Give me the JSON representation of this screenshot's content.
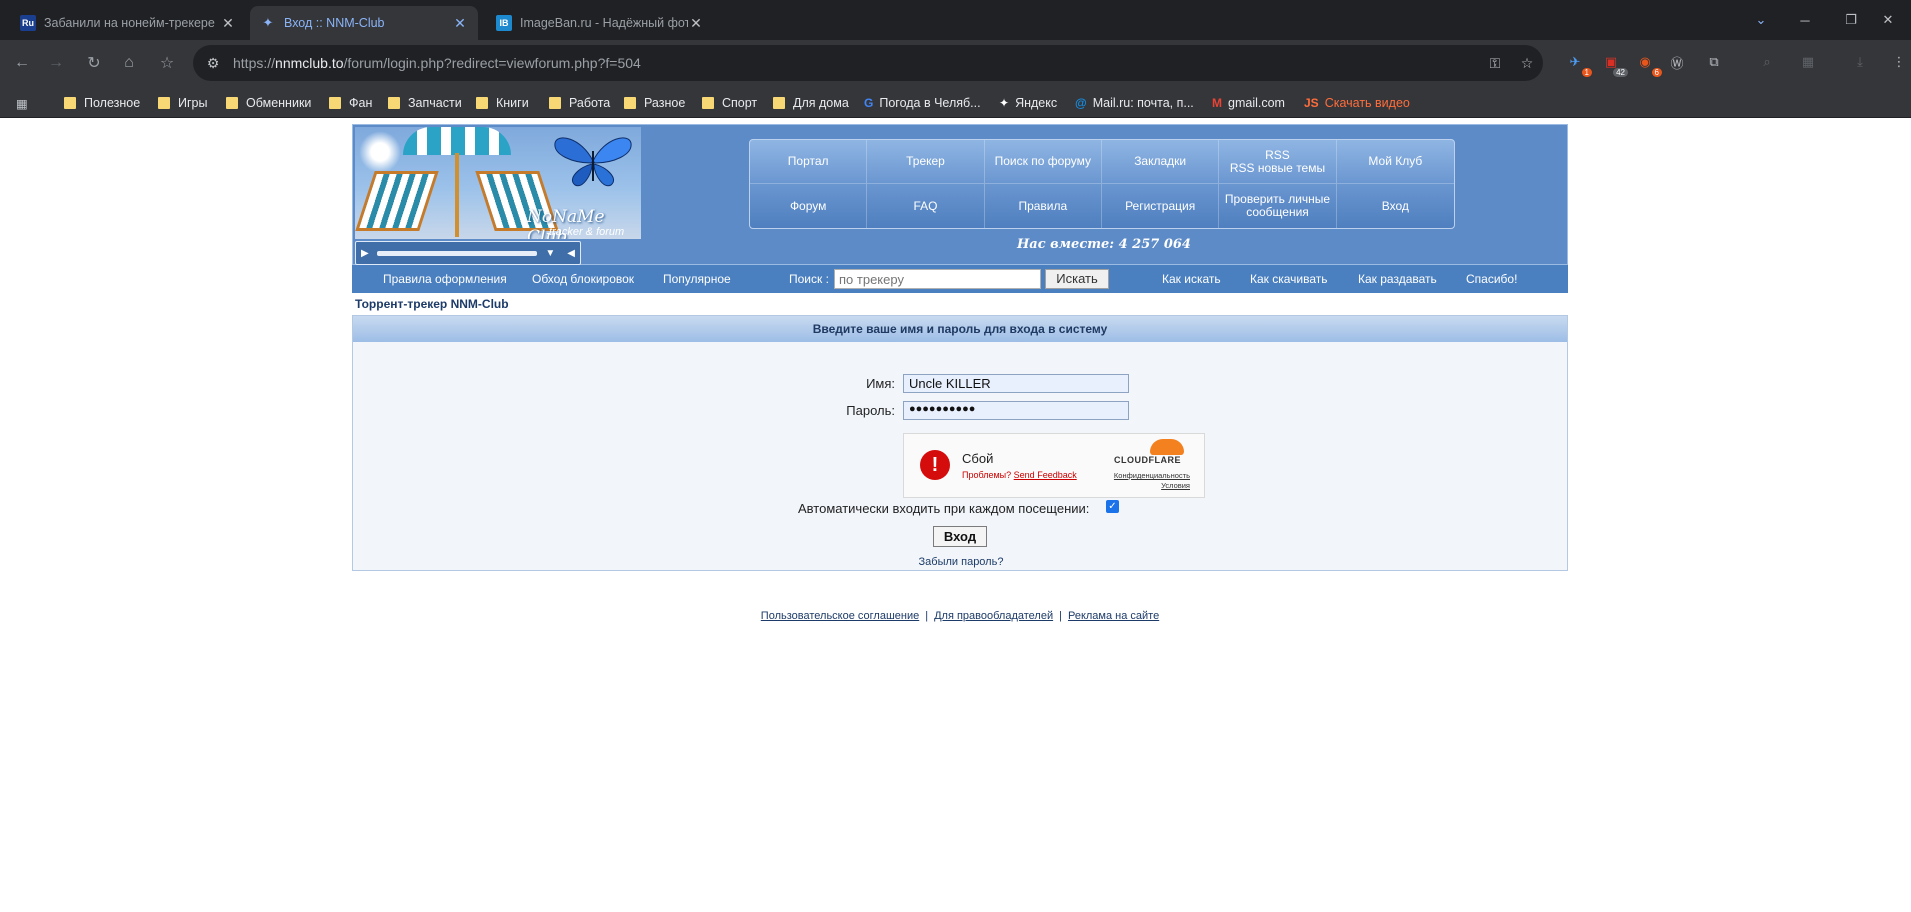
{
  "browser": {
    "tabs": [
      {
        "favicon": "Ru",
        "title": "Забанили на нонейм-трекере"
      },
      {
        "favicon": "butterfly",
        "title": "Вход :: NNM-Club"
      },
      {
        "favicon": "IB",
        "title": "ImageBan.ru - Надёжный фото"
      }
    ],
    "url_prefix": "https://",
    "url_host": "nnmclub.to",
    "url_path": "/forum/login.php?redirect=viewforum.php?f=504",
    "extension_badges": [
      "1",
      "42",
      "6"
    ],
    "bookmarks": [
      {
        "label": "Полезное",
        "type": "folder"
      },
      {
        "label": "Игры",
        "type": "folder"
      },
      {
        "label": "Обменники",
        "type": "folder"
      },
      {
        "label": "Фан",
        "type": "folder"
      },
      {
        "label": "Запчасти",
        "type": "folder"
      },
      {
        "label": "Книги",
        "type": "folder"
      },
      {
        "label": "Работа",
        "type": "folder"
      },
      {
        "label": "Разное",
        "type": "folder"
      },
      {
        "label": "Спорт",
        "type": "folder"
      },
      {
        "label": "Для дома",
        "type": "folder"
      },
      {
        "label": "Погода в Челяб...",
        "type": "link"
      },
      {
        "label": "Яндекс",
        "type": "link"
      },
      {
        "label": "Mail.ru: почта, п...",
        "type": "link"
      },
      {
        "label": "gmail.com",
        "type": "link"
      },
      {
        "label": "Скачать видео",
        "type": "link"
      }
    ]
  },
  "site": {
    "logo_name": "NoNaMe Club",
    "logo_sub": "tracker & forum",
    "nav": [
      "Портал",
      "Трекер",
      "Поиск по форуму",
      "Закладки",
      "RSS\nRSS новые темы",
      "Мой Клуб",
      "Форум",
      "FAQ",
      "Правила",
      "Регистрация",
      "Проверить личные сообщения",
      "Вход"
    ],
    "together": "Нас вместе: 4 257 064",
    "links": [
      "Правила оформления",
      "Обход блокировок",
      "Популярное"
    ],
    "search_label": "Поиск :",
    "search_placeholder": "по трекеру",
    "search_button": "Искать",
    "help_links": [
      "Как искать",
      "Как скачивать",
      "Как раздавать",
      "Спасибо!"
    ],
    "breadcrumb": "Торрент-трекер NNM-Club"
  },
  "login": {
    "heading": "Введите ваше имя и пароль для входа в систему",
    "name_label": "Имя:",
    "name_value": "Uncle KILLER",
    "password_label": "Пароль:",
    "password_value": "●●●●●●●●●●",
    "captcha_status": "Сбой",
    "captcha_problems": "Проблемы?",
    "captcha_feedback": "Send Feedback",
    "captcha_brand": "CLOUDFLARE",
    "captcha_privacy": "Конфиденциальность",
    "captcha_terms": "Условия",
    "autologin_label": "Автоматически входить при каждом посещении:",
    "autologin_checked": true,
    "submit": "Вход",
    "forgot": "Забыли пароль?"
  },
  "footer": [
    "Пользовательское соглашение",
    "Для правообладателей",
    "Реклама на сайте"
  ]
}
